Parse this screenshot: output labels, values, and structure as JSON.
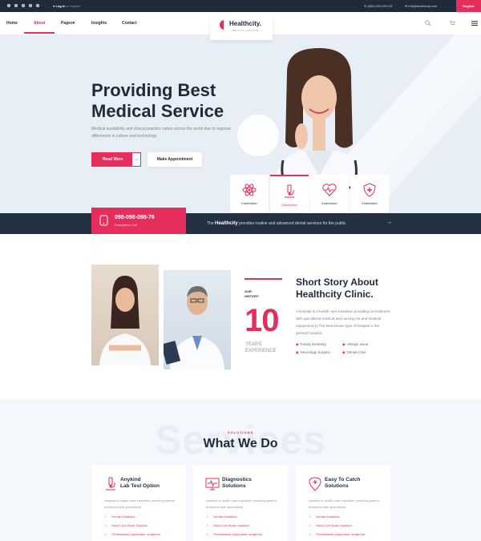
{
  "topbar": {
    "login_bold": "Log In",
    "login_rest": "or register",
    "phone": "(800) 000-000-00",
    "email": "info@healthcity.com",
    "language": "English"
  },
  "nav": {
    "items": [
      {
        "label": "Home"
      },
      {
        "label": "About"
      },
      {
        "label": "Pages"
      },
      {
        "label": "Insights"
      },
      {
        "label": "Contact"
      }
    ],
    "dropdown_caret": "▾"
  },
  "logo": {
    "name": "Healthcity.",
    "tagline": "MEDICAL CENTER"
  },
  "hero": {
    "title_line1": "Providing Best",
    "title_line2": "Medical Service",
    "description": "Medical availability and clinical practice varies across the world due to regional differences in culture and technology.",
    "primary_button": "Read More",
    "primary_arrow": "→",
    "secondary_button": "Make Appointment"
  },
  "feature_cards": [
    {
      "label": "Examination",
      "icon": "atom-icon"
    },
    {
      "label": "Examination",
      "icon": "microscope-icon"
    },
    {
      "label": "Examination",
      "icon": "heartbeat-icon"
    },
    {
      "label": "Examination",
      "icon": "shield-cross-icon"
    }
  ],
  "emergency": {
    "number": "098-098-098-76",
    "label": "Emergency Call"
  },
  "band": {
    "prefix": "The",
    "brand": "Healthcity",
    "text": "provides routine and advanced dental services for the public.",
    "arrow": "→"
  },
  "about": {
    "label_line1": "OUR",
    "label_line2": "HISTORY",
    "years_number": "10",
    "years_line1": "YEARS",
    "years_line2": "EXPERIENCE",
    "title_line1": "Short Story About",
    "title_line2": "Healthcity Clinic.",
    "description": "A hospital is a health care institution providing us treatment with specialized medical and nursing me and medical equipment.[1] The best-known type of hospital is the general hospital.",
    "list": [
      "Family Dentistry",
      "Allergic Issue",
      "Neurology Surgery",
      "Dental Care"
    ],
    "bullet": "◆"
  },
  "services": {
    "background_word": "Services",
    "subtitle": "SOLUTIONS",
    "title": "What We Do",
    "cards": [
      {
        "title_line1": "Anykind",
        "title_line2": "Lab Test Option",
        "description": "Hospital is health care institution providing patient treatment with specialized",
        "icon": "microscope-icon",
        "items": [
          "Dental Solutions",
          "Hard Core Bone Solution",
          "Professional physicians, surgeons"
        ]
      },
      {
        "title_line1": "Diagnostics",
        "title_line2": "Solutions",
        "description": "Hospital is health care institution providing patient treatment with specialized",
        "icon": "monitor-heartbeat-icon",
        "items": [
          "Dental Solutions",
          "Hard Core Bone Solution",
          "Professional physicians, surgeons"
        ]
      },
      {
        "title_line1": "Easy To Catch",
        "title_line2": "Solutions",
        "description": "Hospital is health care institution providing patient treatment with specialized",
        "icon": "location-cross-icon",
        "items": [
          "Dental Solutions",
          "Hard Core Bone Solution",
          "Professional physicians, surgeons"
        ]
      }
    ],
    "check": "✓"
  },
  "colors": {
    "accent": "#e62e5c",
    "dark": "#233041",
    "hero_bg": "#e8eef6",
    "text": "#1d2b3a"
  }
}
